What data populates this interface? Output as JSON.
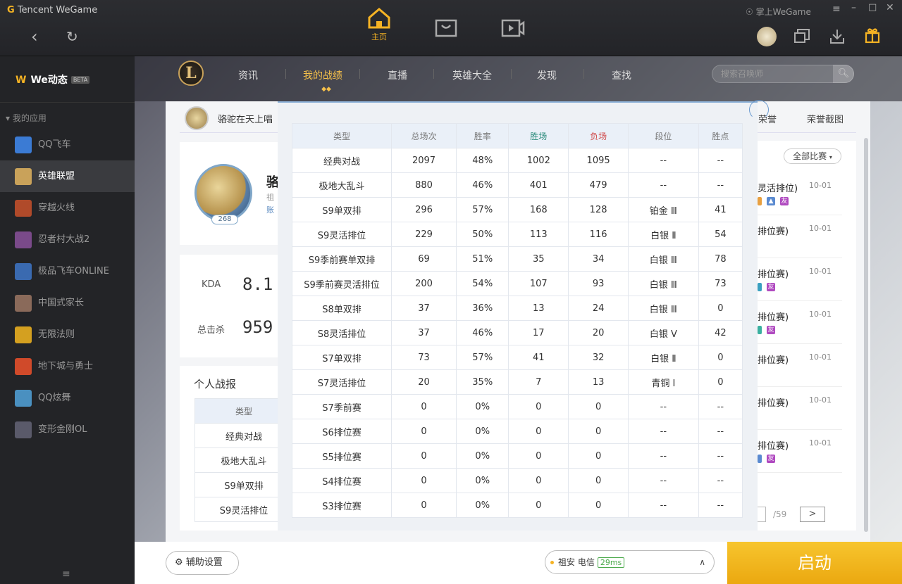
{
  "app": {
    "brand_prefix": "G",
    "brand": "Tencent WeGame",
    "home_label": "主页",
    "mobile_wegame": "掌上WeGame"
  },
  "sidebar": {
    "we_dynamic": "We动态",
    "beta": "BETA",
    "my_apps": "我的应用",
    "apps": [
      "QQ飞车",
      "英雄联盟",
      "穿越火线",
      "忍者村大战2",
      "极品飞车ONLINE",
      "中国式家长",
      "无限法则",
      "地下城与勇士",
      "QQ炫舞",
      "变形金刚OL"
    ]
  },
  "topnav": {
    "logo": "L",
    "tabs": [
      "资讯",
      "我的战绩",
      "直播",
      "英雄大全",
      "发现",
      "查找"
    ],
    "active": "我的战绩",
    "search_placeholder": "搜索召唤师"
  },
  "player": {
    "name": "骆驼在天上唱",
    "name_short": "骆",
    "line1": "祖",
    "line2": "账",
    "level": "268"
  },
  "kda": {
    "label": "KDA",
    "value": "8.1"
  },
  "kills": {
    "label": "总击杀",
    "value": "959"
  },
  "report": {
    "title": "个人战报",
    "header": "类型",
    "rows": [
      "经典对战",
      "极地大乱斗",
      "S9单双排",
      "S9灵活排位"
    ]
  },
  "right_panel": {
    "honor": "荣誉",
    "honor_shot": "荣誉截图",
    "filter": "全部比赛",
    "matches": [
      {
        "title": "灵活排位)",
        "date": "10-01"
      },
      {
        "title": "排位赛)",
        "date": "10-01"
      },
      {
        "title": "排位赛)",
        "date": "10-01"
      },
      {
        "title": "排位赛)",
        "date": "10-01"
      },
      {
        "title": "排位赛)",
        "date": "10-01"
      },
      {
        "title": "排位赛)",
        "date": "10-01"
      },
      {
        "title": "排位赛)",
        "date": "10-01"
      }
    ],
    "tag_friend": "友",
    "page_total": "/59",
    "next": ">"
  },
  "stats": {
    "headers": [
      "类型",
      "总场次",
      "胜率",
      "胜场",
      "负场",
      "段位",
      "胜点"
    ],
    "rows": [
      [
        "经典对战",
        "2097",
        "48%",
        "1002",
        "1095",
        "--",
        "--"
      ],
      [
        "极地大乱斗",
        "880",
        "46%",
        "401",
        "479",
        "--",
        "--"
      ],
      [
        "S9单双排",
        "296",
        "57%",
        "168",
        "128",
        "铂金 Ⅲ",
        "41"
      ],
      [
        "S9灵活排位",
        "229",
        "50%",
        "113",
        "116",
        "白银 Ⅱ",
        "54"
      ],
      [
        "S9季前赛单双排",
        "69",
        "51%",
        "35",
        "34",
        "白银 Ⅲ",
        "78"
      ],
      [
        "S9季前赛灵活排位",
        "200",
        "54%",
        "107",
        "93",
        "白银 Ⅲ",
        "73"
      ],
      [
        "S8单双排",
        "37",
        "36%",
        "13",
        "24",
        "白银 Ⅲ",
        "0"
      ],
      [
        "S8灵活排位",
        "37",
        "46%",
        "17",
        "20",
        "白银 Ⅴ",
        "42"
      ],
      [
        "S7单双排",
        "73",
        "57%",
        "41",
        "32",
        "白银 Ⅱ",
        "0"
      ],
      [
        "S7灵活排位",
        "20",
        "35%",
        "7",
        "13",
        "青铜 Ⅰ",
        "0"
      ],
      [
        "S7季前赛",
        "0",
        "0%",
        "0",
        "0",
        "--",
        "--"
      ],
      [
        "S6排位赛",
        "0",
        "0%",
        "0",
        "0",
        "--",
        "--"
      ],
      [
        "S5排位赛",
        "0",
        "0%",
        "0",
        "0",
        "--",
        "--"
      ],
      [
        "S4排位赛",
        "0",
        "0%",
        "0",
        "0",
        "--",
        "--"
      ],
      [
        "S3排位赛",
        "0",
        "0%",
        "0",
        "0",
        "--",
        "--"
      ]
    ]
  },
  "footer": {
    "assist": "辅助设置",
    "server": "祖安 电信",
    "ping": "29ms",
    "launch": "启动"
  },
  "colors": {
    "accent": "#f5b324",
    "win": "#2a8a7a",
    "loss": "#d14b4b"
  }
}
